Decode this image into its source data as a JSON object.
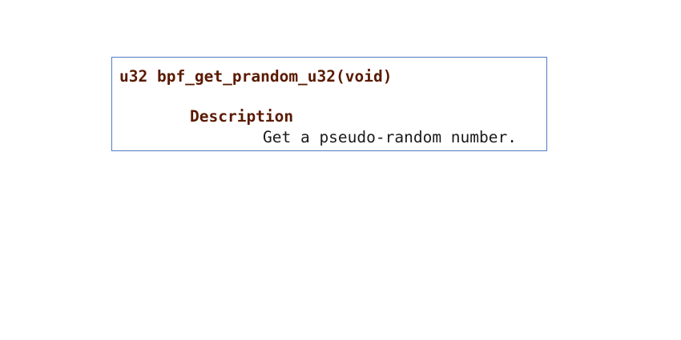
{
  "doc": {
    "signature": "u32 bpf_get_prandom_u32(void)",
    "section_heading": "Description",
    "section_body": "Get a pseudo-random number.",
    "heading_color": "#5a1a00",
    "border_color": "#4f7bc4"
  }
}
